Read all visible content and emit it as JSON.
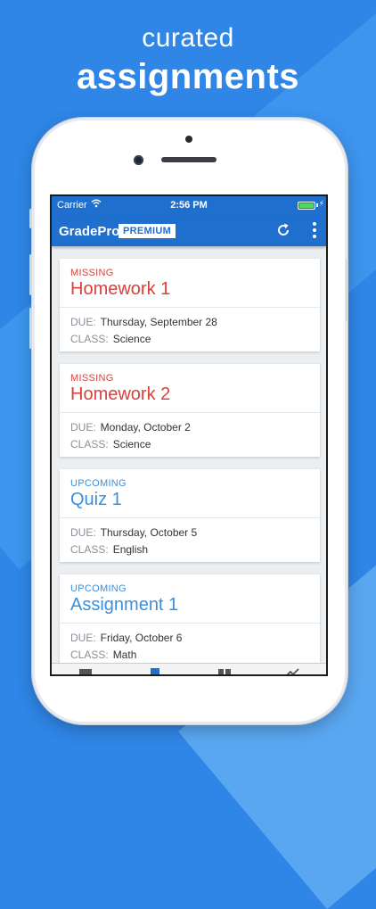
{
  "promo": {
    "line1": "curated",
    "line2": "assignments"
  },
  "status_bar": {
    "carrier": "Carrier",
    "time": "2:56 PM"
  },
  "app": {
    "title": "GradePro",
    "badge": "PREMIUM"
  },
  "labels": {
    "due": "DUE:",
    "class": "CLASS:"
  },
  "assignments": [
    {
      "status": "MISSING",
      "name": "Homework 1",
      "due": "Thursday, September 28",
      "class": "Science"
    },
    {
      "status": "MISSING",
      "name": "Homework 2",
      "due": "Monday, October 2",
      "class": "Science"
    },
    {
      "status": "UPCOMING",
      "name": "Quiz 1",
      "due": "Thursday, October 5",
      "class": "English"
    },
    {
      "status": "UPCOMING",
      "name": "Assignment 1",
      "due": "Friday, October 6",
      "class": "Math"
    }
  ],
  "colors": {
    "brand": "#1f6fcf",
    "missing": "#d9413b",
    "upcoming": "#3a8fdc",
    "background": "#2f86e6"
  },
  "icons": [
    "wifi-icon",
    "battery-icon",
    "refresh-icon",
    "more-vert-icon",
    "news-tab-icon",
    "assignments-tab-icon",
    "classes-tab-icon",
    "grades-tab-icon"
  ]
}
